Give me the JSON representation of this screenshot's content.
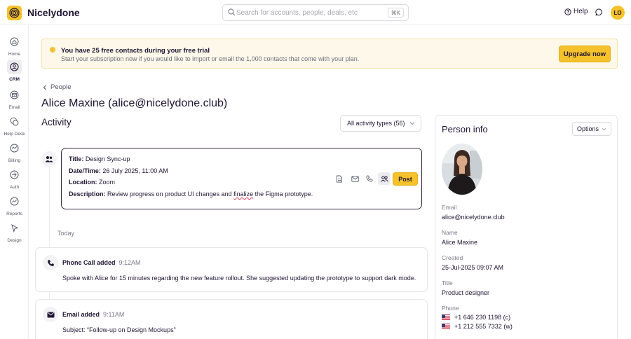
{
  "app": {
    "name": "Nicelydone"
  },
  "header": {
    "search_placeholder": "Search for accounts, people, deals, etc",
    "search_shortcut": "⌘K",
    "help_label": "Help",
    "user_initials": "LO"
  },
  "sidebar": {
    "items": [
      {
        "label": "Home",
        "icon": "home-icon",
        "active": false
      },
      {
        "label": "CRM",
        "icon": "crm-icon",
        "active": true
      },
      {
        "label": "Email",
        "icon": "email-icon",
        "active": false
      },
      {
        "label": "Help Desk",
        "icon": "help-desk-icon",
        "active": false
      },
      {
        "label": "Billing",
        "icon": "billing-icon",
        "active": false
      },
      {
        "label": "Auth",
        "icon": "auth-icon",
        "active": false
      },
      {
        "label": "Reports",
        "icon": "reports-icon",
        "active": false
      },
      {
        "label": "Design",
        "icon": "design-icon",
        "active": false
      }
    ]
  },
  "banner": {
    "title": "You have 25 free contacts during your free trial",
    "subtitle": "Start your subscription now if you would like to import or email the 1,000 contacts that come with your plan.",
    "button": "Upgrade now"
  },
  "breadcrumb": {
    "back_label": "People"
  },
  "page": {
    "title": "Alice Maxine (alice@nicelydone.club)"
  },
  "activity": {
    "title": "Activity",
    "filter_label": "All activity types (56)",
    "composer": {
      "title_label": "Title:",
      "title_value": "Design Sync-up",
      "datetime_label": "Date/Time:",
      "datetime_value": "26 July 2025, 11:00 AM",
      "location_label": "Location:",
      "location_value": "Zoom",
      "description_label": "Description:",
      "description_value_a": "Review progress on product UI changes and ",
      "description_value_err": "finalize",
      "description_value_b": " the Figma prototype.",
      "post_button": "Post"
    },
    "group_label": "Today",
    "items": [
      {
        "title": "Phone Call added",
        "time": "9:12AM",
        "body": "Spoke with Alice for 15 minutes regarding the new feature rollout. She suggested updating the prototype to support dark mode."
      },
      {
        "title": "Email added",
        "time": "9:11AM",
        "body": "Subject: “Follow-up on Design Mockups”"
      }
    ]
  },
  "person_info": {
    "title": "Person info",
    "options_label": "Options",
    "fields": {
      "email_label": "Email",
      "email_value": "alice@nicelydone.club",
      "name_label": "Name",
      "name_value": "Alice Maxine",
      "created_label": "Created",
      "created_value": "25-Jul-2025 09:07 AM",
      "title_label": "Title",
      "title_value": "Product designer",
      "phone_label": "Phone",
      "phones": [
        "+1 646 230 1198 (c)",
        "+1 212 555 7332 (w)"
      ]
    }
  },
  "colors": {
    "accent": "#f6c22b",
    "text": "#1f1633",
    "composer_border": "#3a2745",
    "banner_bg": "#fdf8e9"
  }
}
